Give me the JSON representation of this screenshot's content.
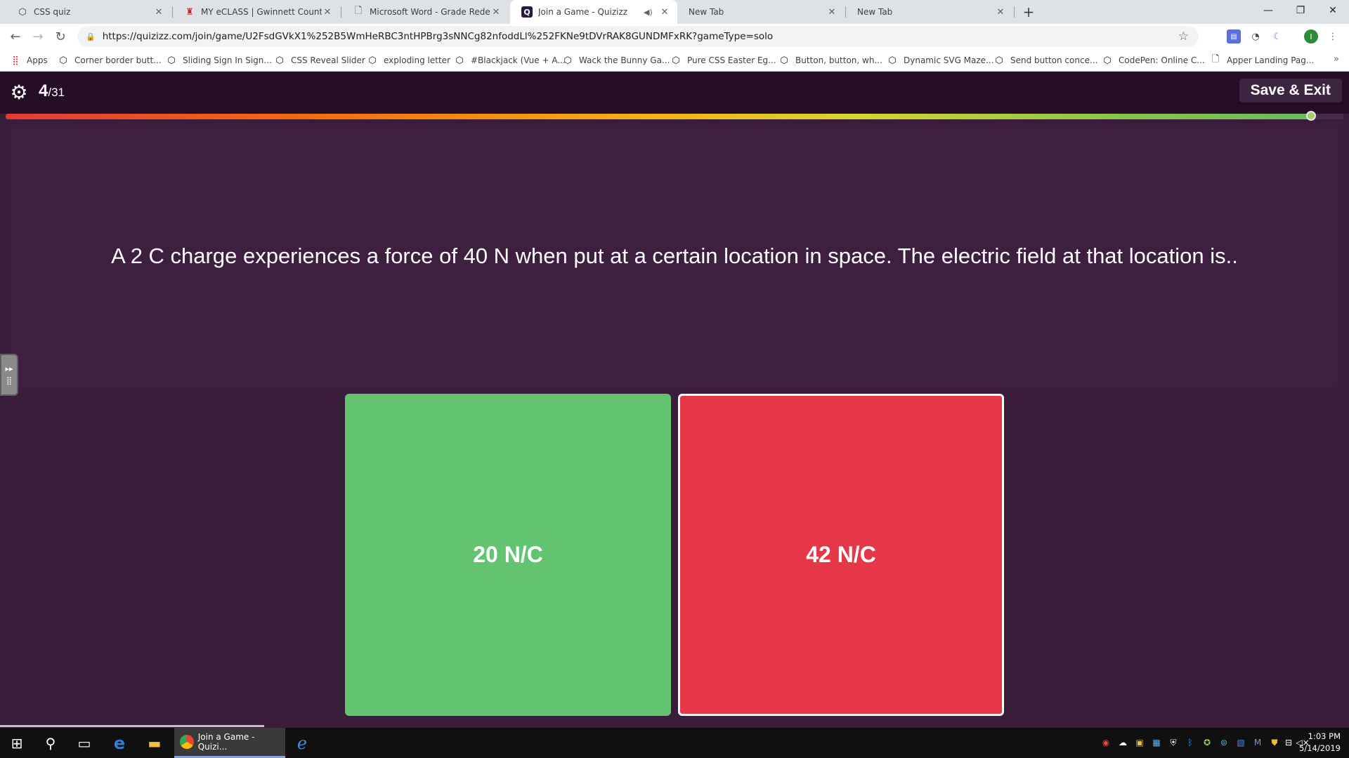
{
  "browser": {
    "tabs": [
      {
        "title": "CSS quiz",
        "icon": "codepen-icon"
      },
      {
        "title": "MY eCLASS | Gwinnett County Pu",
        "icon": "school-icon"
      },
      {
        "title": "Microsoft Word - Grade Redemp",
        "icon": "document-icon"
      },
      {
        "title": "Join a Game - Quizizz",
        "icon": "quizizz-icon",
        "active": true,
        "audio": true
      },
      {
        "title": "New Tab",
        "icon": ""
      },
      {
        "title": "New Tab",
        "icon": ""
      }
    ],
    "url": "https://quizizz.com/join/game/U2FsdGVkX1%252B5WmHeRBC3ntHPBrg3sNNCg82nfoddLl%252FKNe9tDVrRAK8GUNDMFxRK?gameType=solo",
    "profile_initial": "I",
    "bookmarks": [
      {
        "label": "Apps",
        "icon": "apps-grid-icon"
      },
      {
        "label": "Corner border butt...",
        "icon": "codepen-icon"
      },
      {
        "label": "Sliding Sign In Sign...",
        "icon": "codepen-icon"
      },
      {
        "label": "CSS Reveal Slider",
        "icon": "codepen-icon"
      },
      {
        "label": "exploding letter",
        "icon": "codepen-icon"
      },
      {
        "label": "#Blackjack (Vue + A...",
        "icon": "codepen-icon"
      },
      {
        "label": "Wack the Bunny Ga...",
        "icon": "codepen-icon"
      },
      {
        "label": "Pure CSS Easter Eg...",
        "icon": "codepen-icon"
      },
      {
        "label": "Button, button, wh...",
        "icon": "codepen-icon"
      },
      {
        "label": "Dynamic SVG Maze...",
        "icon": "codepen-icon"
      },
      {
        "label": "Send button conce...",
        "icon": "codepen-icon"
      },
      {
        "label": "CodePen: Online C...",
        "icon": "codepen-icon"
      },
      {
        "label": "Apper Landing Pag...",
        "icon": "document-icon"
      }
    ]
  },
  "quiz": {
    "current": "4",
    "total": "/31",
    "save_exit_label": "Save & Exit",
    "progress": 0.976,
    "question": "A 2 C charge experiences a force of 40 N when put at a certain location in space. The electric field at that location is..",
    "answers": [
      {
        "label": "20 N/C",
        "color": "#62c371"
      },
      {
        "label": "42 N/C",
        "color": "#e63748"
      }
    ]
  },
  "taskbar": {
    "active_app_label": "Join a Game - Quizi...",
    "time": "1:03 PM",
    "date": "5/14/2019"
  }
}
